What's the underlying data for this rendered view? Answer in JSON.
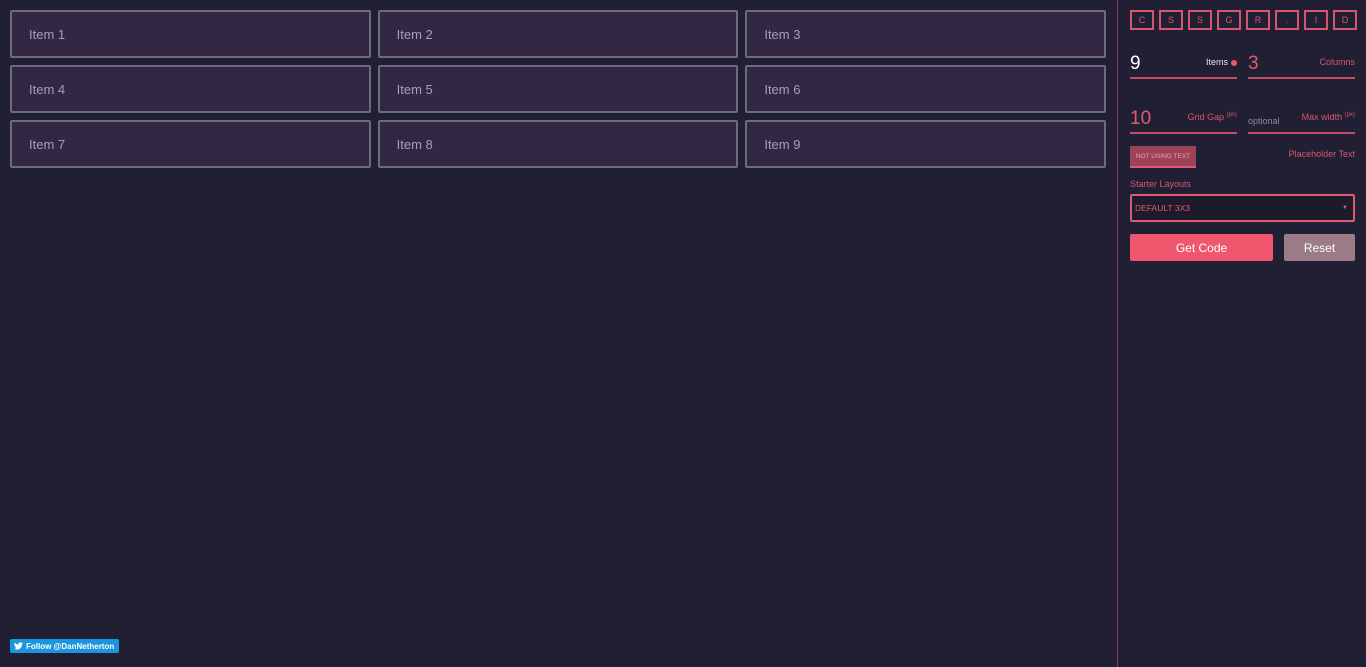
{
  "grid": {
    "items": [
      "Item 1",
      "Item 2",
      "Item 3",
      "Item 4",
      "Item 5",
      "Item 6",
      "Item 7",
      "Item 8",
      "Item 9"
    ]
  },
  "follow": {
    "label": "Follow @DanNetherton",
    "icon": "twitter-bird-icon"
  },
  "sidebar": {
    "logo_letters": [
      "C",
      "S",
      "S",
      "G",
      "R",
      ".",
      "I",
      "D"
    ],
    "items_field": {
      "value": "9",
      "label": "Items"
    },
    "columns_field": {
      "value": "3",
      "label": "Columns"
    },
    "gap_field": {
      "value": "10",
      "label": "Grid Gap",
      "unit": "(px)"
    },
    "maxwidth_field": {
      "placeholder": "optional",
      "label": "Max width",
      "unit": "(px)"
    },
    "text_toggle": "NOT USING TEXT",
    "placeholder_text_label": "Placeholder Text",
    "starter_label": "Starter Layouts",
    "starter_selected": "DEFAULT 3X3",
    "get_code": "Get Code",
    "reset": "Reset"
  },
  "colors": {
    "accent": "#f0566d",
    "background": "#211f33",
    "cell": "#322843"
  }
}
